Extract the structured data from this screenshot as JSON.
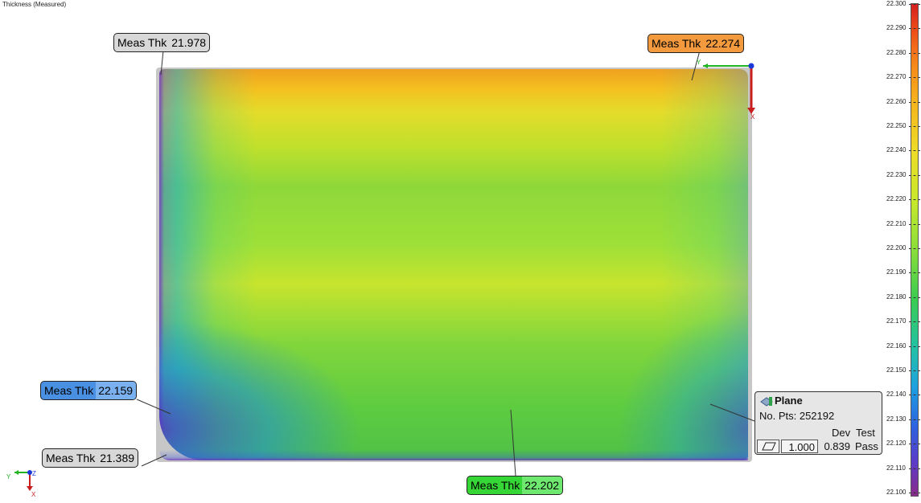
{
  "title": "Thickness (Measured)",
  "colors": {
    "callout_gray": "#d8d8d8",
    "callout_orange": "#f39a3e",
    "callout_blue": "#4a90e2",
    "callout_green": "#37d637",
    "panel_bg": "#e6e6e6"
  },
  "callouts": [
    {
      "label": "Meas Thk",
      "value": "21.978",
      "color": "gray"
    },
    {
      "label": "Meas Thk",
      "value": "22.274",
      "color": "orange"
    },
    {
      "label": "Meas Thk",
      "value": "22.159",
      "color": "blue"
    },
    {
      "label": "Meas Thk",
      "value": "21.389",
      "color": "gray"
    },
    {
      "label": "Meas Thk",
      "value": "22.202",
      "color": "green"
    }
  ],
  "legend": {
    "ticks": [
      "22.300",
      "22.290",
      "22.280",
      "22.270",
      "22.260",
      "22.250",
      "22.240",
      "22.230",
      "22.220",
      "22.210",
      "22.200",
      "22.190",
      "22.180",
      "22.170",
      "22.160",
      "22.150",
      "22.140",
      "22.130",
      "22.120",
      "22.110",
      "22.100"
    ]
  },
  "panel": {
    "icon": "plane-icon",
    "title": "Plane",
    "points": "No. Pts: 252192",
    "headers": {
      "dev": "Dev",
      "test": "Test"
    },
    "row": {
      "tolerance": "1.000",
      "dev": "0.839",
      "test": "Pass",
      "icon": "flatness-icon"
    }
  },
  "axes": {
    "top_right": {
      "y": "Y",
      "x": "X"
    },
    "bottom_left": {
      "y": "Y",
      "x": "X",
      "z": "Z"
    }
  }
}
